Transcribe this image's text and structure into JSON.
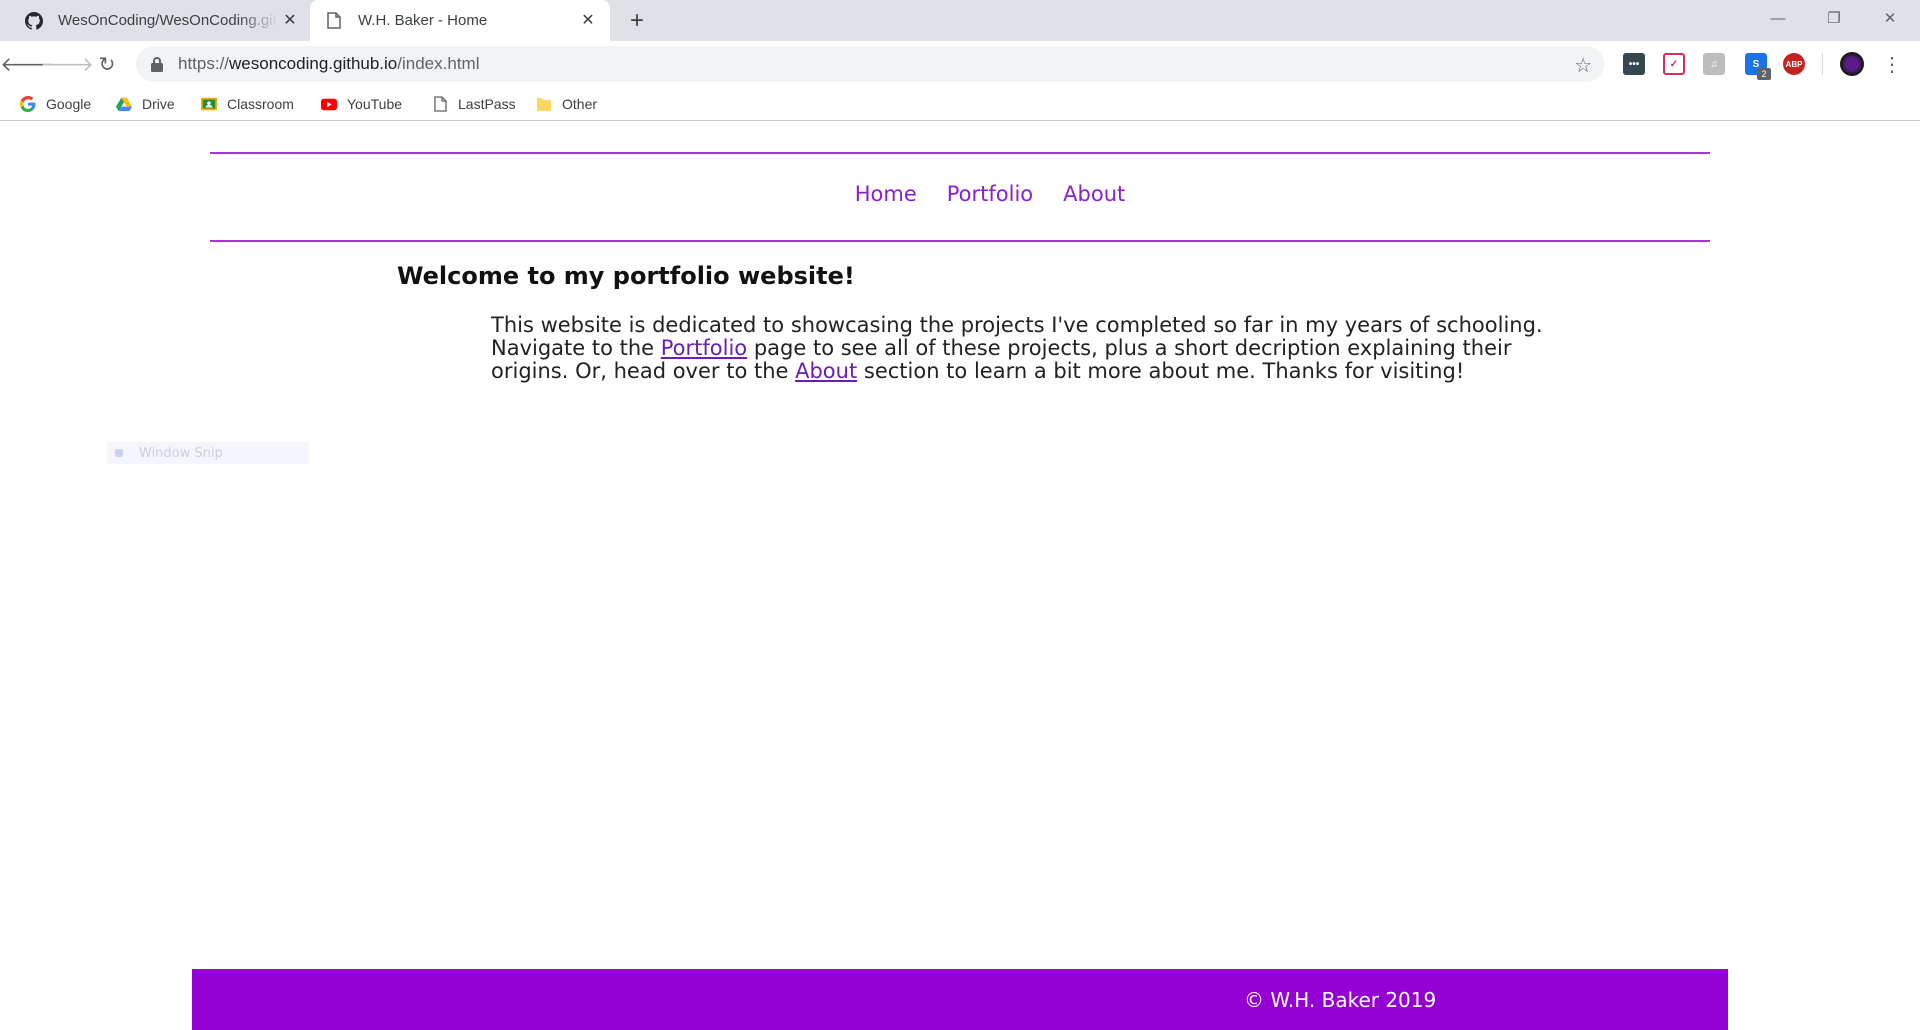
{
  "browser": {
    "tabs": [
      {
        "title": "WesOnCoding/WesOnCoding.github.io",
        "icon": "github-icon",
        "active": false
      },
      {
        "title": "W.H. Baker - Home",
        "icon": "page-icon",
        "active": true
      }
    ],
    "address_bar": {
      "url_scheme": "https://",
      "url_host": "wesoncoding.github.io",
      "url_path": "/index.html"
    },
    "extensions": {
      "ext4_badge": "2",
      "ext5_label": "ABP"
    },
    "bookmarks": [
      {
        "label": "Google",
        "icon": "google-icon"
      },
      {
        "label": "Drive",
        "icon": "drive-icon"
      },
      {
        "label": "Classroom",
        "icon": "classroom-icon"
      },
      {
        "label": "YouTube",
        "icon": "youtube-icon"
      },
      {
        "label": "LastPass",
        "icon": "page-icon"
      },
      {
        "label": "Other",
        "icon": "folder-icon"
      }
    ]
  },
  "site": {
    "nav": {
      "home": "Home",
      "portfolio": "Portfolio",
      "about": "About"
    },
    "heading": "Welcome to my portfolio website!",
    "intro": {
      "part1": "This website is dedicated to showcasing the projects I've completed so far in my years of schooling. Navigate to the ",
      "link1": "Portfolio",
      "part2": " page to see all of these projects, plus a short decription explaining their origins. Or, head over to the ",
      "link2": "About",
      "part3": " section to learn a bit more about me. Thanks for visiting!"
    },
    "overlay_ghost": "Window Snip",
    "footer": "© W.H. Baker 2019",
    "colors": {
      "accent": "#9400d3",
      "link": "#8a1fd1"
    }
  }
}
